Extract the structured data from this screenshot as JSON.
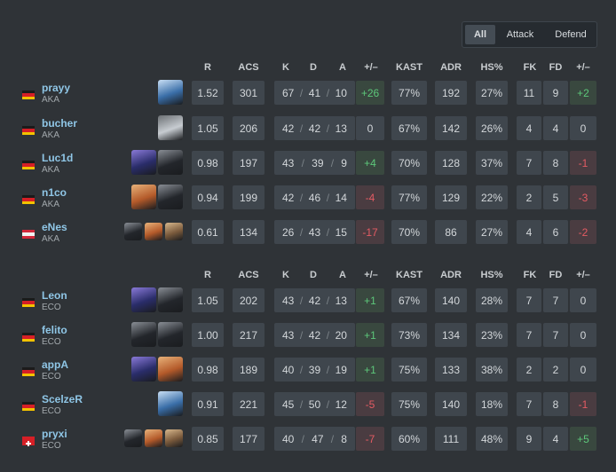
{
  "filters": [
    "All",
    "Attack",
    "Defend"
  ],
  "headers": [
    "R",
    "ACS",
    "K",
    "D",
    "A",
    "+/–",
    "KAST",
    "ADR",
    "HS%",
    "FK",
    "FD",
    "+/–"
  ],
  "colors": {
    "positive": "#5dc77a",
    "negative": "#e35b63",
    "name": "#8fc6e6"
  },
  "teams": [
    {
      "players": [
        {
          "name": "prayy",
          "team": "AKA",
          "flag": "de",
          "agents": [
            "blue-agent"
          ],
          "r": "1.52",
          "acs": "301",
          "k": "67",
          "d": "41",
          "a": "10",
          "pm": "+26",
          "pm_sign": "pos",
          "kast": "77%",
          "adr": "192",
          "hs": "27%",
          "fk": "11",
          "fd": "9",
          "fkpm": "+2",
          "fkpm_sign": "pos"
        },
        {
          "name": "bucher",
          "team": "AKA",
          "flag": "de",
          "agents": [
            "white-agent"
          ],
          "r": "1.05",
          "acs": "206",
          "k": "42",
          "d": "42",
          "a": "13",
          "pm": "0",
          "pm_sign": "zero",
          "kast": "67%",
          "adr": "142",
          "hs": "26%",
          "fk": "4",
          "fd": "4",
          "fkpm": "0",
          "fkpm_sign": "zero"
        },
        {
          "name": "Luc1d",
          "team": "AKA",
          "flag": "de",
          "agents": [
            "purple-agent",
            "dark-agent"
          ],
          "r": "0.98",
          "acs": "197",
          "k": "43",
          "d": "39",
          "a": "9",
          "pm": "+4",
          "pm_sign": "pos",
          "kast": "70%",
          "adr": "128",
          "hs": "37%",
          "fk": "7",
          "fd": "8",
          "fkpm": "-1",
          "fkpm_sign": "neg"
        },
        {
          "name": "n1co",
          "team": "AKA",
          "flag": "de",
          "agents": [
            "orange-agent",
            "dark-agent"
          ],
          "r": "0.94",
          "acs": "199",
          "k": "42",
          "d": "46",
          "a": "14",
          "pm": "-4",
          "pm_sign": "neg",
          "kast": "77%",
          "adr": "129",
          "hs": "22%",
          "fk": "2",
          "fd": "5",
          "fkpm": "-3",
          "fkpm_sign": "neg"
        },
        {
          "name": "eNes",
          "team": "AKA",
          "flag": "at",
          "agents": [
            "dark-agent",
            "orange-agent",
            "tan-agent"
          ],
          "r": "0.61",
          "acs": "134",
          "k": "26",
          "d": "43",
          "a": "15",
          "pm": "-17",
          "pm_sign": "neg",
          "kast": "70%",
          "adr": "86",
          "hs": "27%",
          "fk": "4",
          "fd": "6",
          "fkpm": "-2",
          "fkpm_sign": "neg"
        }
      ]
    },
    {
      "players": [
        {
          "name": "Leon",
          "team": "ECO",
          "flag": "de",
          "agents": [
            "purple-agent",
            "dark-agent"
          ],
          "r": "1.05",
          "acs": "202",
          "k": "43",
          "d": "42",
          "a": "13",
          "pm": "+1",
          "pm_sign": "pos",
          "kast": "67%",
          "adr": "140",
          "hs": "28%",
          "fk": "7",
          "fd": "7",
          "fkpm": "0",
          "fkpm_sign": "zero"
        },
        {
          "name": "felito",
          "team": "ECO",
          "flag": "de",
          "agents": [
            "dark-agent",
            "dark-agent"
          ],
          "r": "1.00",
          "acs": "217",
          "k": "43",
          "d": "42",
          "a": "20",
          "pm": "+1",
          "pm_sign": "pos",
          "kast": "73%",
          "adr": "134",
          "hs": "23%",
          "fk": "7",
          "fd": "7",
          "fkpm": "0",
          "fkpm_sign": "zero"
        },
        {
          "name": "appA",
          "team": "ECO",
          "flag": "de",
          "agents": [
            "purple-agent",
            "orange-agent"
          ],
          "r": "0.98",
          "acs": "189",
          "k": "40",
          "d": "39",
          "a": "19",
          "pm": "+1",
          "pm_sign": "pos",
          "kast": "75%",
          "adr": "133",
          "hs": "38%",
          "fk": "2",
          "fd": "2",
          "fkpm": "0",
          "fkpm_sign": "zero"
        },
        {
          "name": "ScelzeR",
          "team": "ECO",
          "flag": "de",
          "agents": [
            "blue-agent"
          ],
          "r": "0.91",
          "acs": "221",
          "k": "45",
          "d": "50",
          "a": "12",
          "pm": "-5",
          "pm_sign": "neg",
          "kast": "75%",
          "adr": "140",
          "hs": "18%",
          "fk": "7",
          "fd": "8",
          "fkpm": "-1",
          "fkpm_sign": "neg"
        },
        {
          "name": "pryxi",
          "team": "ECO",
          "flag": "ch",
          "agents": [
            "dark-agent",
            "orange-agent",
            "tan-agent"
          ],
          "r": "0.85",
          "acs": "177",
          "k": "40",
          "d": "47",
          "a": "8",
          "pm": "-7",
          "pm_sign": "neg",
          "kast": "60%",
          "adr": "111",
          "hs": "48%",
          "fk": "9",
          "fd": "4",
          "fkpm": "+5",
          "fkpm_sign": "pos"
        }
      ]
    }
  ]
}
